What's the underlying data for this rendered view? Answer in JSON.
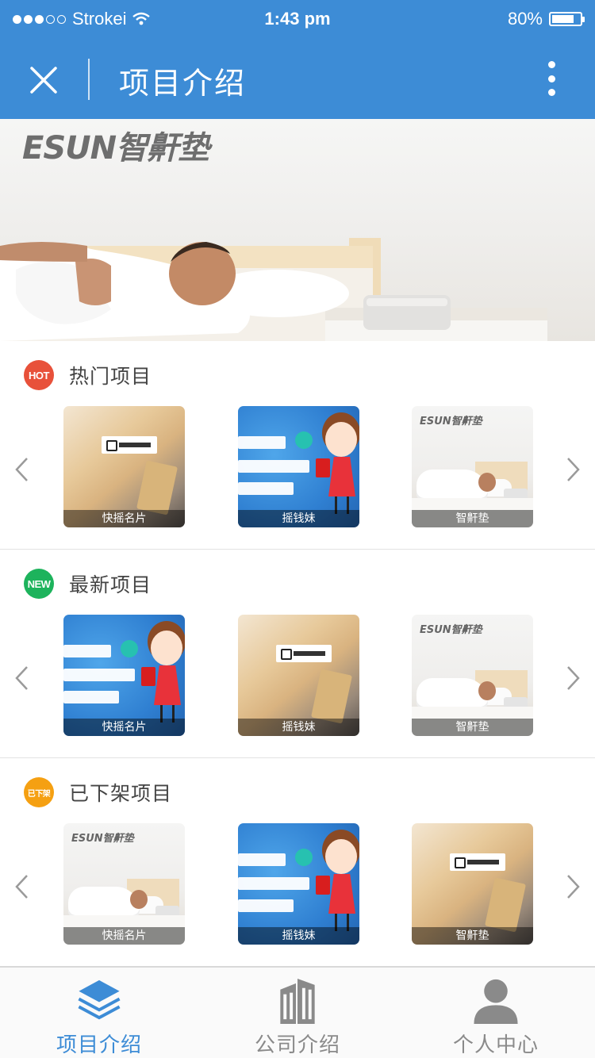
{
  "status_bar": {
    "carrier": "Strokei",
    "time": "1:43 pm",
    "battery": "80%",
    "battery_level": 0.8
  },
  "nav": {
    "title": "项目介绍",
    "close_icon": "close-icon",
    "more_icon": "more-vertical-icon"
  },
  "banner": {
    "logo_text": "ESUN智鼾垫"
  },
  "sections": [
    {
      "badge": "HOT",
      "badge_color": "#e8513a",
      "title": "热门项目",
      "cards": [
        {
          "caption": "快摇名片"
        },
        {
          "caption": "摇钱妹"
        },
        {
          "caption": "智鼾垫",
          "logo": "ESUN智鼾垫"
        }
      ]
    },
    {
      "badge": "NEW",
      "badge_color": "#1db35c",
      "title": "最新项目",
      "cards": [
        {
          "caption": "快摇名片"
        },
        {
          "caption": "摇钱妹"
        },
        {
          "caption": "智鼾垫",
          "logo": "ESUN智鼾垫"
        }
      ]
    },
    {
      "badge": "已下架",
      "badge_color": "#f5a012",
      "title": "已下架项目",
      "cards": [
        {
          "caption": "快摇名片",
          "logo": "ESUN智鼾垫"
        },
        {
          "caption": "摇钱妹"
        },
        {
          "caption": "智鼾垫"
        }
      ]
    }
  ],
  "tabs": [
    {
      "label": "项目介绍",
      "icon": "layers-icon",
      "active": true
    },
    {
      "label": "公司介绍",
      "icon": "building-icon",
      "active": false
    },
    {
      "label": "个人中心",
      "icon": "person-icon",
      "active": false
    }
  ],
  "colors": {
    "brand_blue": "#3d8cd6",
    "inactive_gray": "#8a8a8a"
  }
}
